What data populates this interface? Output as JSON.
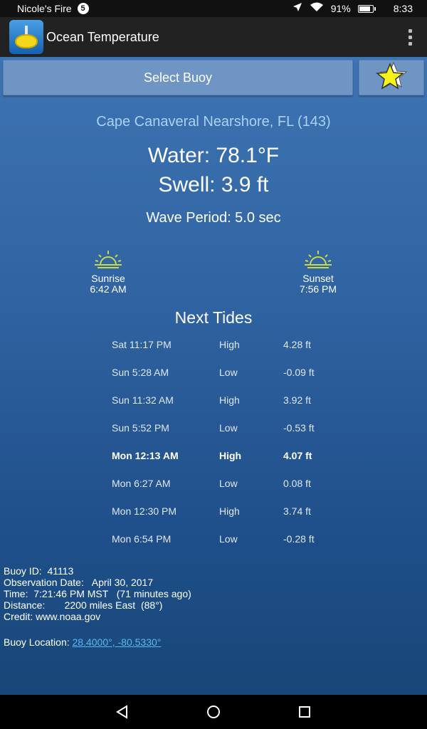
{
  "status_bar": {
    "device_name": "Nicole's Fire",
    "notification_count": "5",
    "battery": "91%",
    "battery_level": 0.91,
    "time": "8:33"
  },
  "app_bar": {
    "title": "Ocean Temperature"
  },
  "controls": {
    "select_buoy_label": "Select Buoy"
  },
  "buoy": {
    "name": "Cape Canaveral Nearshore, FL (143)",
    "water": "Water: 78.1°F",
    "swell": "Swell: 3.9 ft",
    "wave_period": "Wave Period:  5.0 sec"
  },
  "sun": {
    "sunrise_label": "Sunrise",
    "sunrise_time": "6:42 AM",
    "sunset_label": "Sunset",
    "sunset_time": "7:56 PM"
  },
  "tides": {
    "title": "Next Tides",
    "rows": [
      {
        "time": "Sat 11:17 PM",
        "type": "High",
        "height": "4.28 ft",
        "bold": false
      },
      {
        "time": "Sun 5:28 AM",
        "type": "Low",
        "height": "-0.09 ft",
        "bold": false
      },
      {
        "time": "Sun 11:32 AM",
        "type": "High",
        "height": "3.92 ft",
        "bold": false
      },
      {
        "time": "Sun 5:52 PM",
        "type": "Low",
        "height": "-0.53 ft",
        "bold": false
      },
      {
        "time": "Mon 12:13 AM",
        "type": "High",
        "height": "4.07 ft",
        "bold": true
      },
      {
        "time": "Mon 6:27 AM",
        "type": "Low",
        "height": "0.08 ft",
        "bold": false
      },
      {
        "time": "Mon 12:30 PM",
        "type": "High",
        "height": "3.74 ft",
        "bold": false
      },
      {
        "time": "Mon 6:54 PM",
        "type": "Low",
        "height": "-0.28 ft",
        "bold": false
      }
    ]
  },
  "info": {
    "buoy_id": "Buoy ID:  41113",
    "observation_date": "Observation Date:   April 30, 2017",
    "time": "Time:  7:21:46 PM MST   (71 minutes ago)",
    "distance": "Distance:       2200 miles East  (88°)",
    "credit": "Credit: www.noaa.gov",
    "location_label": "Buoy Location: ",
    "location_link": "28.4000°, -80.5330°"
  },
  "colors": {
    "accent_text": "#a9d2f5",
    "link": "#5ab8f0",
    "sun_icon": "#c8d84a",
    "star": "#f7f21a"
  },
  "icons": {
    "favorites": "star-icon",
    "sunrise": "sunrise-icon",
    "sunset": "sunset-icon",
    "menu": "overflow-menu-icon"
  }
}
